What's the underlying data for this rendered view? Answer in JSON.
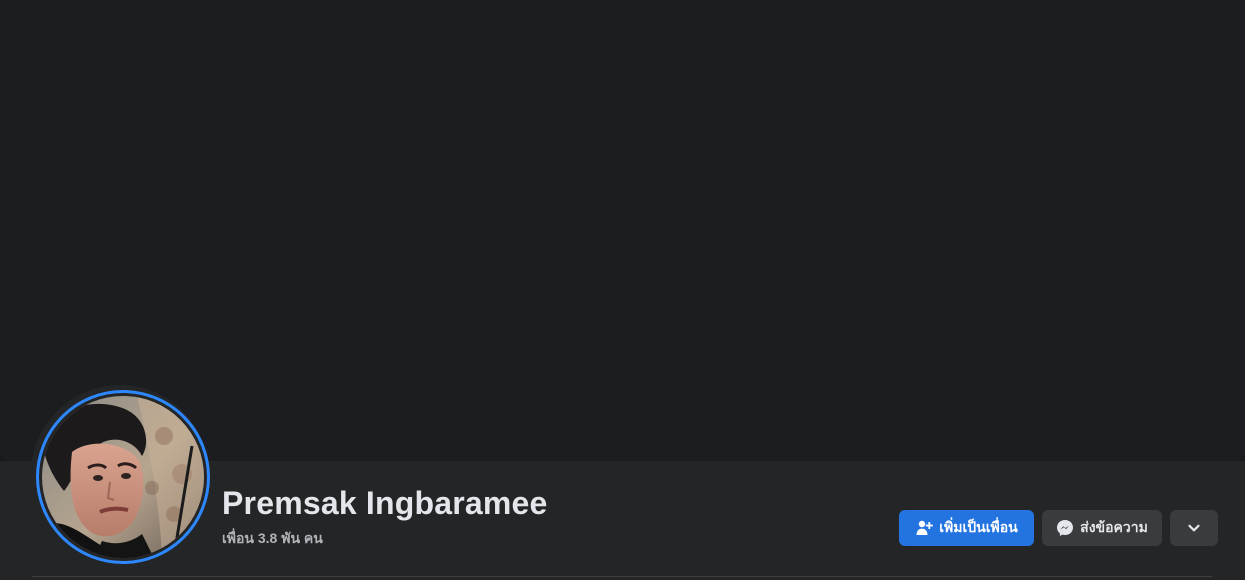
{
  "profile": {
    "name": "Premsak Ingbaramee",
    "friends_text": "เพื่อน 3.8 พัน คน"
  },
  "actions": {
    "add_friend_label": "เพิ่มเป็นเพื่อน",
    "message_label": "ส่งข้อความ",
    "add_friend_icon": "add-friend-icon",
    "message_icon": "messenger-icon",
    "more_icon": "chevron-down-icon"
  },
  "colors": {
    "cover": "#1c1d20",
    "profile_bar": "#242526",
    "primary_button": "#2374e1",
    "secondary_button": "#3a3b3c",
    "avatar_ring": "#2d88ff",
    "name_text": "#e4e6eb",
    "muted_text": "#b0b3b8"
  }
}
